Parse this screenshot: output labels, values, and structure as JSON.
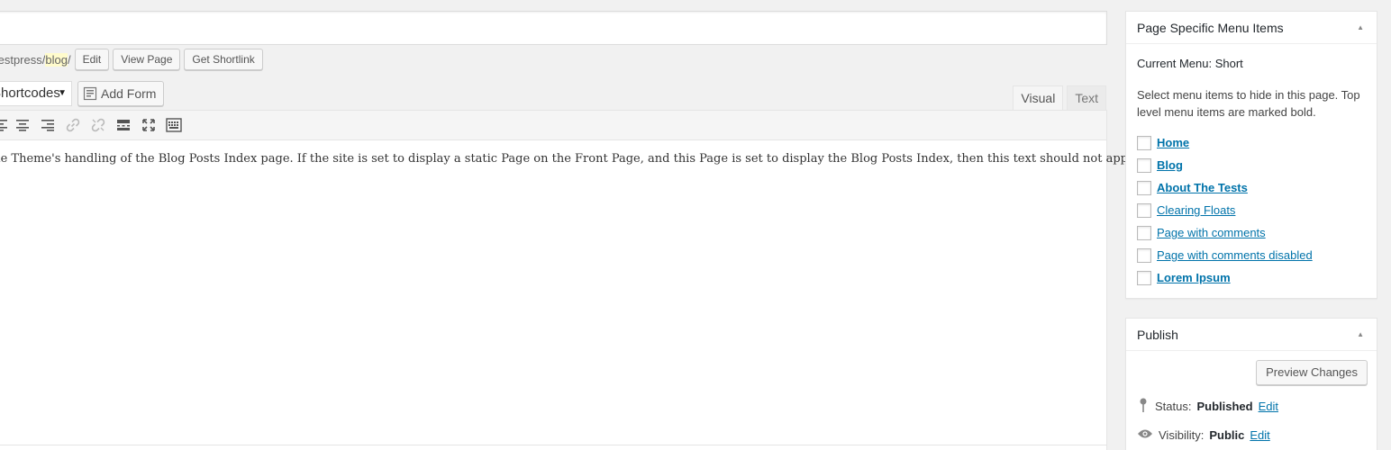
{
  "permalink": {
    "url_prefix": "testpress/",
    "slug": "blog",
    "url_suffix": "/",
    "edit_label": "Edit",
    "view_label": "View Page",
    "shortlink_label": "Get Shortlink"
  },
  "media": {
    "shortcodes_value": "Shortcodes",
    "add_form_label": "Add Form"
  },
  "editor": {
    "tabs": [
      {
        "label": "Visual",
        "active": true
      },
      {
        "label": "Text",
        "active": false
      }
    ],
    "toolbar_icons": [
      "align-left-icon",
      "align-center-icon",
      "align-right-icon",
      "insert-link-icon",
      "remove-link-icon",
      "read-more-icon",
      "fullscreen-icon",
      "toolbar-toggle-icon"
    ],
    "content": "the Theme's handling of the Blog Posts Index page. If the site is set to display a static Page on the Front Page, and this Page is set to display the Blog Posts Index, then this text should not appear."
  },
  "menu_box": {
    "title": "Page Specific Menu Items",
    "current_menu": "Current Menu: Short",
    "description": "Select menu items to hide in this page. Top level menu items are marked bold.",
    "items": [
      {
        "label": "Home",
        "bold": true
      },
      {
        "label": "Blog",
        "bold": true
      },
      {
        "label": "About The Tests",
        "bold": true
      },
      {
        "label": "Clearing Floats",
        "bold": false
      },
      {
        "label": "Page with comments",
        "bold": false
      },
      {
        "label": "Page with comments disabled",
        "bold": false
      },
      {
        "label": "Lorem Ipsum",
        "bold": true
      }
    ]
  },
  "publish_box": {
    "title": "Publish",
    "preview_label": "Preview Changes",
    "status_label": "Status:",
    "status_value": "Published",
    "visibility_label": "Visibility:",
    "visibility_value": "Public",
    "edit_label": "Edit"
  },
  "colors": {
    "link": "#0073aa",
    "background": "#f1f1f1",
    "slug_highlight": "#fffbcc"
  }
}
